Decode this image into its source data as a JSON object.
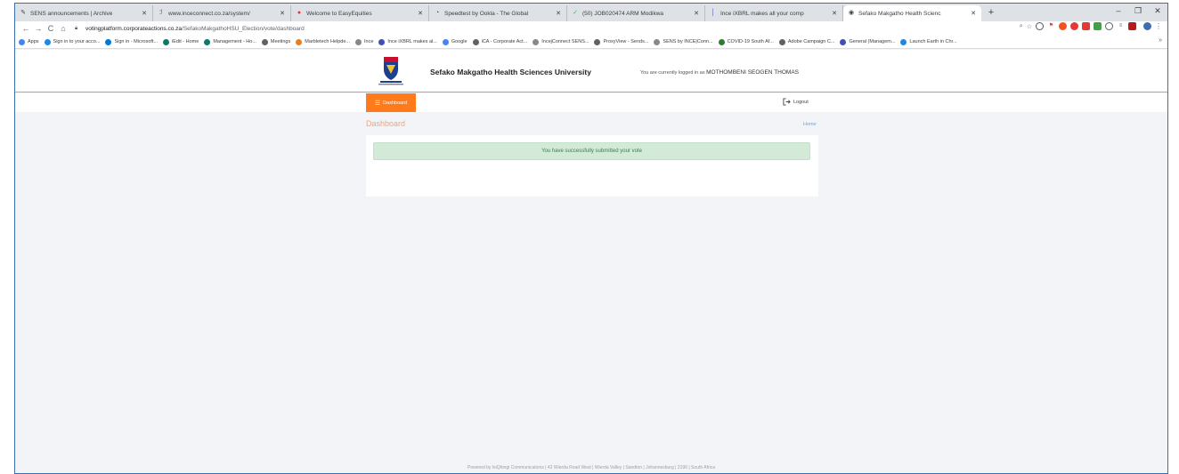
{
  "browser": {
    "tabs": [
      {
        "title": "SENS announcements | Archive",
        "favicon_color": "#7aa5d9"
      },
      {
        "title": "www.inceconnect.co.za/system/",
        "favicon_color": "#888888"
      },
      {
        "title": "Welcome to EasyEquities",
        "favicon_color": "#e53935"
      },
      {
        "title": "Speedtest by Ookla - The Global",
        "favicon_color": "#444444"
      },
      {
        "title": "(50) JOB020474 ARM Modikwa",
        "favicon_color": "#4caf50"
      },
      {
        "title": "Ince iXBRL makes all your comp",
        "favicon_color": "#3f51b5"
      },
      {
        "title": "Sefako Makgatho Health Scienc",
        "favicon_color": "#5f6368"
      }
    ],
    "new_tab": "+",
    "window_controls": {
      "minimize": "–",
      "restore": "❐",
      "close": "✕"
    },
    "nav": {
      "back": "←",
      "forward": "→",
      "reload": "C",
      "home": "⌂"
    },
    "url": {
      "host": "votingplatform.corporateactions.co.za",
      "path": "/SefakoMakgathoHSU_Election/vote/dashboard"
    },
    "bookmarks": [
      {
        "label": "Apps",
        "color": "#4285f4"
      },
      {
        "label": "Sign in to your acco...",
        "color": "#1e88e5"
      },
      {
        "label": "Sign in - Microsoft...",
        "color": "#0078d4"
      },
      {
        "label": "iEdit - Home",
        "color": "#0a7a6a"
      },
      {
        "label": "Management - Ho...",
        "color": "#0a7a6a"
      },
      {
        "label": "Meetings",
        "color": "#5f6368"
      },
      {
        "label": "Marbletech Helpde...",
        "color": "#e67e22"
      },
      {
        "label": "Ince",
        "color": "#888888"
      },
      {
        "label": "Ince iXBRL makes al...",
        "color": "#3f51b5"
      },
      {
        "label": "Google",
        "color": "#4285f4"
      },
      {
        "label": "iCA - Corporate Act...",
        "color": "#5f6368"
      },
      {
        "label": "IncejConnect SENS...",
        "color": "#888888"
      },
      {
        "label": "ProxyView - Sends...",
        "color": "#5f6368"
      },
      {
        "label": "SENS by INCE|Conn...",
        "color": "#888888"
      },
      {
        "label": "COVID-19 South Af...",
        "color": "#2e7d32"
      },
      {
        "label": "Adobe Campaign C...",
        "color": "#5f6368"
      },
      {
        "label": "General (Managem...",
        "color": "#3f51b5"
      },
      {
        "label": "Launch Earth in Chr...",
        "color": "#1e88e5"
      }
    ],
    "bookmarks_more": "»"
  },
  "site": {
    "university_name": "Sefako Makgatho Health Sciences University",
    "logged_in_prefix": "You are currently logged in as",
    "logged_in_user": "MOTHOMBENI SEOGEN THOMAS",
    "nav": {
      "dashboard": "Dashboard",
      "logout": "Logout"
    },
    "page_title": "Dashboard",
    "breadcrumb_home": "Home",
    "alert_message": "You have successfully submitted your vote",
    "footer": "Powered by IsiQhingi Communications | 42 Wierda Road West | Wierda Valley | Sandton | Johannesburg | 2196 | South Africa"
  },
  "colors": {
    "accent_orange": "#ff7a1a",
    "success_bg": "#d4ead8",
    "success_text": "#3f7a4d"
  }
}
